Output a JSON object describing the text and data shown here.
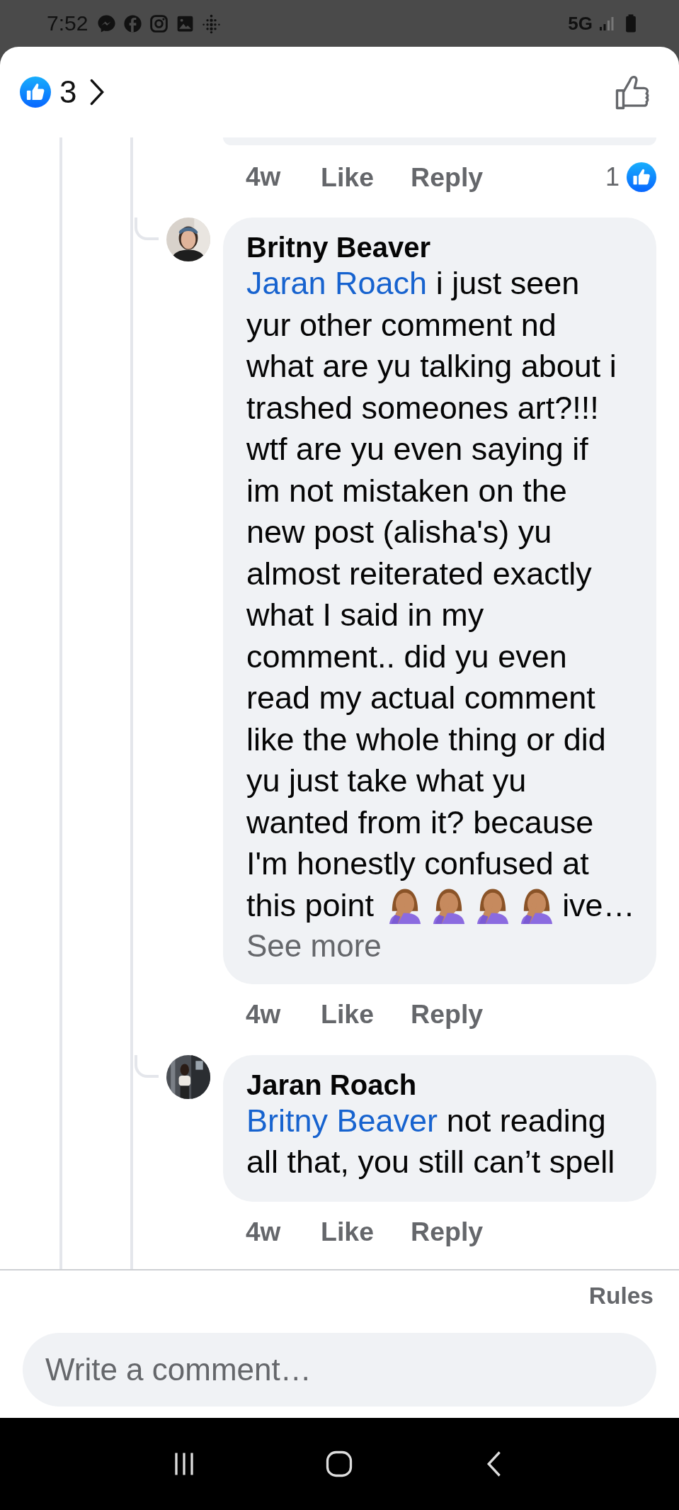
{
  "status_bar": {
    "time": "7:52",
    "network": "5G"
  },
  "header": {
    "reaction_count": "3"
  },
  "top_comment": {
    "time": "4w",
    "like": "Like",
    "reply": "Reply",
    "reaction_count": "1"
  },
  "replies": [
    {
      "author": "Britny Beaver",
      "mention": "Jaran Roach",
      "lines": [
        "i just seen",
        "yur other comment nd",
        "what are yu talking about i",
        "trashed someones art?!!!",
        "wtf are yu even saying if",
        "im not mistaken on the",
        "new post (alisha's) yu",
        "almost reiterated exactly",
        "what I said in my",
        "comment.. did yu even",
        "read my actual comment",
        "like the whole thing or did",
        "yu just take what yu",
        "wanted from it? because",
        "I'm honestly confused at"
      ],
      "last_line": "this point",
      "emojis": [
        {
          "kind": "facepalm"
        },
        {
          "kind": "facepalm"
        },
        {
          "kind": "facepalm"
        },
        {
          "kind": "facepalm"
        }
      ],
      "truncated_text": "ive…",
      "see_more": "See more",
      "time": "4w",
      "like": "Like",
      "reply": "Reply"
    },
    {
      "author": "Jaran Roach",
      "mention": "Britny Beaver",
      "lines": [
        "not reading",
        "all that, you still can’t spell"
      ],
      "time": "4w",
      "like": "Like",
      "reply": "Reply"
    }
  ],
  "footer": {
    "rules": "Rules",
    "composer": {
      "placeholder": "Write a comment…"
    }
  }
}
